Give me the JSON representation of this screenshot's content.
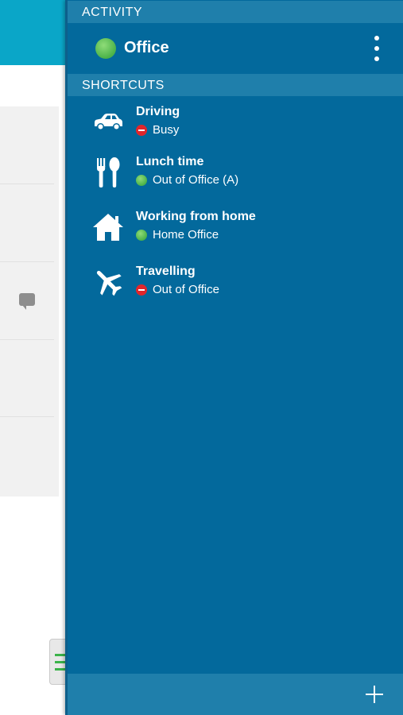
{
  "drawer": {
    "activity_header": "ACTIVITY",
    "current_activity": {
      "label": "Office",
      "status": "available",
      "status_color": "#4bb249"
    },
    "shortcuts_header": "SHORTCUTS",
    "shortcuts": [
      {
        "title": "Driving",
        "status": "Busy",
        "status_color": "#e0262b",
        "icon": "car-icon"
      },
      {
        "title": "Lunch time",
        "status": "Out of Office (A)",
        "status_color": "#4bb249",
        "icon": "fork-spoon-icon"
      },
      {
        "title": "Working from home",
        "status": "Home Office",
        "status_color": "#4bb249",
        "icon": "home-icon"
      },
      {
        "title": "Travelling",
        "status": "Out of Office",
        "status_color": "#e0262b",
        "icon": "airplane-icon"
      }
    ],
    "background_color": "#03699c",
    "header_color": "#1f7fab"
  },
  "background_app": {
    "header_color": "#0aa6c8"
  }
}
